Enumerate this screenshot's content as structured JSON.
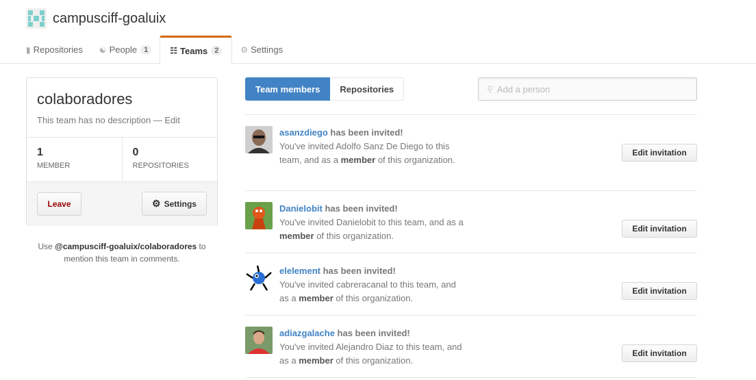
{
  "org": {
    "name": "campusciff-goaluix",
    "avatar_icon": "identicon-icon"
  },
  "tabs": [
    {
      "label": "Repositories",
      "icon": "repo-icon",
      "count": ""
    },
    {
      "label": "People",
      "icon": "people-icon",
      "count": "1"
    },
    {
      "label": "Teams",
      "icon": "teams-icon",
      "count": "2"
    },
    {
      "label": "Settings",
      "icon": "gear-icon",
      "count": ""
    }
  ],
  "team": {
    "name": "colaboradores",
    "description": "This team has no description — Edit",
    "members_count": "1",
    "members_label": "MEMBER",
    "repos_count": "0",
    "repos_label": "REPOSITORIES",
    "leave_label": "Leave",
    "settings_label": "Settings",
    "mention_prefix": "Use ",
    "mention_handle": "@campusciff-goaluix/colaboradores",
    "mention_suffix": " to mention this team in comments."
  },
  "subnav": {
    "members_label": "Team members",
    "repos_label": "Repositories"
  },
  "add_person": {
    "placeholder": "Add a person"
  },
  "members": [
    {
      "user": "asanzdiego",
      "status": " has been invited!",
      "line_pre": "You've invited Adolfo Sanz De Diego to this team, and as a ",
      "role": "member",
      "line_post": " of this organization.",
      "button": "Edit invitation"
    },
    {
      "user": "Danielobit",
      "status": " has been invited!",
      "line_pre": "You've invited Danielobit to this team, and as a ",
      "role": "member",
      "line_post": " of this organization.",
      "button": "Edit invitation"
    },
    {
      "user": "elelement",
      "status": " has been invited!",
      "line_pre": "You've invited cabreracanal to this team, and as a ",
      "role": "member",
      "line_post": " of this organization.",
      "button": "Edit invitation"
    },
    {
      "user": "adiazgalache",
      "status": " has been invited!",
      "line_pre": "You've invited Alejandro Diaz to this team, and as a ",
      "role": "member",
      "line_post": " of this organization.",
      "button": "Edit invitation"
    }
  ],
  "colors": {
    "accent": "#4183c4",
    "tab_highlight": "#d26911",
    "leave": "#990000"
  }
}
